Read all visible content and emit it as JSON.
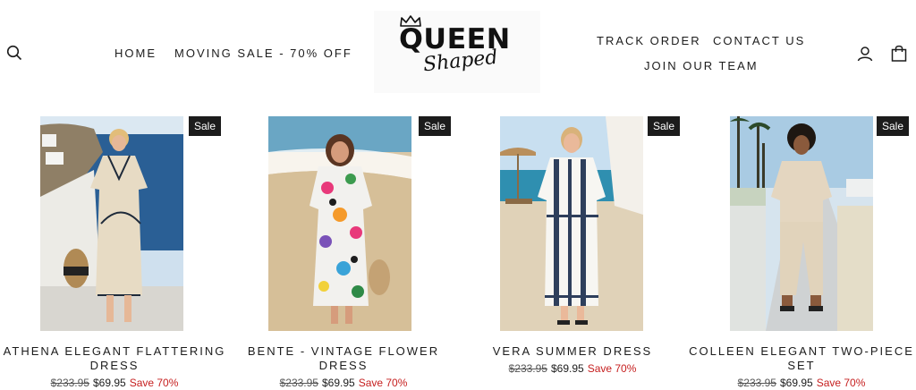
{
  "header": {
    "nav_left": [
      {
        "label": "HOME"
      },
      {
        "label": "MOVING SALE - 70% OFF"
      }
    ],
    "nav_right": [
      {
        "label": "TRACK ORDER"
      },
      {
        "label": "CONTACT US"
      },
      {
        "label": "JOIN OUR TEAM"
      }
    ],
    "logo": {
      "word1": "QUEEN",
      "word2": "Shaped"
    },
    "icons": {
      "search": "search-icon",
      "account": "user-icon",
      "cart": "shopping-bag-icon"
    }
  },
  "products": [
    {
      "badge": "Sale",
      "title_line1": "ATHENA ELEGANT FLATTERING",
      "title_line2": "DRESS",
      "old_price": "$233.95",
      "price": "$69.95",
      "save": "Save 70%"
    },
    {
      "badge": "Sale",
      "title_line1": "BENTE - VINTAGE FLOWER",
      "title_line2": "DRESS",
      "old_price": "$233.95",
      "price": "$69.95",
      "save": "Save 70%"
    },
    {
      "badge": "Sale",
      "title_line1": "VERA SUMMER DRESS",
      "title_line2": "",
      "old_price": "$233.95",
      "price": "$69.95",
      "save": "Save 70%"
    },
    {
      "badge": "Sale",
      "title_line1": "COLLEEN ELEGANT TWO-PIECE",
      "title_line2": "SET",
      "old_price": "$233.95",
      "price": "$69.95",
      "save": "Save 70%"
    }
  ],
  "colors": {
    "text": "#1c1c1c",
    "badge_bg": "#1c1c1c",
    "save_red": "#c62020"
  }
}
